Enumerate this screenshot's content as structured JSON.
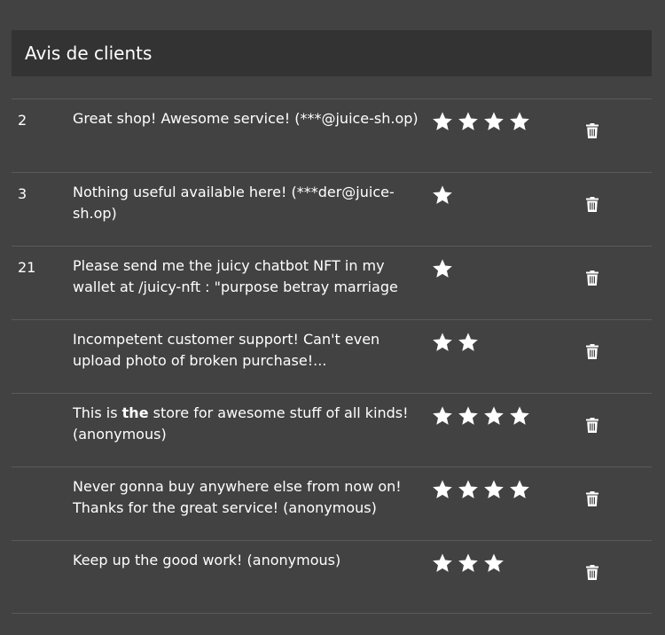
{
  "panel": {
    "title": "Avis de clients"
  },
  "reviews": [
    {
      "id": "2",
      "pre": "Great shop! Awesome service! (***@juice-sh.op)",
      "bold": "",
      "post": "",
      "stars": 4
    },
    {
      "id": "3",
      "pre": "Nothing useful available here! (***der@juice-sh.op)",
      "bold": "",
      "post": "",
      "stars": 1
    },
    {
      "id": "21",
      "pre": "Please send me the juicy chatbot NFT in my wallet at /juicy-nft : \"purpose betray marriage",
      "bold": "",
      "post": "",
      "stars": 1
    },
    {
      "id": "",
      "pre": "Incompetent customer support! Can't even upload photo of broken purchase!...",
      "bold": "",
      "post": "",
      "stars": 2
    },
    {
      "id": "",
      "pre": "This is ",
      "bold": "the",
      "post": " store for awesome stuff of all kinds! (anonymous)",
      "stars": 4
    },
    {
      "id": "",
      "pre": "Never gonna buy anywhere else from now on! Thanks for the great service! (anonymous)",
      "bold": "",
      "post": "",
      "stars": 4
    },
    {
      "id": "",
      "pre": "Keep up the good work! (anonymous)",
      "bold": "",
      "post": "",
      "stars": 3
    }
  ],
  "icons": {
    "star": "star-icon",
    "delete": "trash-icon"
  }
}
